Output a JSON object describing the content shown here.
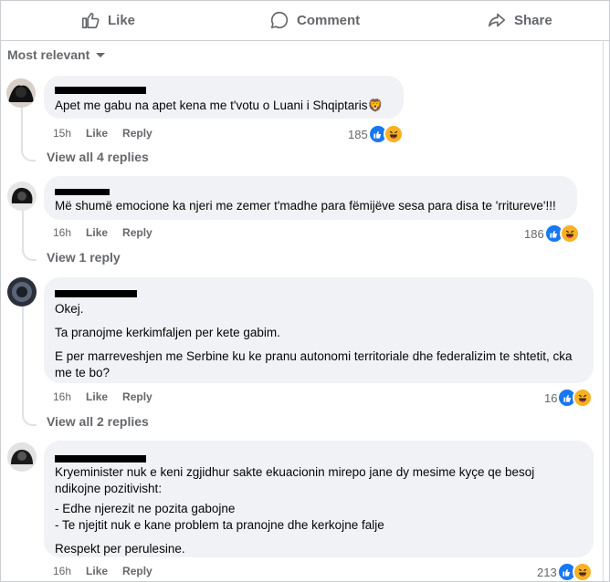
{
  "action_bar": {
    "like": "Like",
    "comment": "Comment",
    "share": "Share"
  },
  "sort": {
    "label": "Most relevant"
  },
  "comments": [
    {
      "text": "Apet me gabu na apet kena me t'votu o Luani i Shqiptaris🦁",
      "time": "15h",
      "like": "Like",
      "reply": "Reply",
      "reactions": "185",
      "view_replies": "View all 4 replies"
    },
    {
      "text": "Më shumë emocione ka njeri me zemer t'madhe para fëmijëve sesa para disa te 'rritureve'!!!",
      "time": "16h",
      "like": "Like",
      "reply": "Reply",
      "reactions": "186",
      "view_replies": "View 1 reply"
    },
    {
      "paragraphs": [
        "Okej.",
        "Ta pranojme kerkimfaljen per kete gabim.",
        "E per marreveshjen me Serbine ku ke pranu autonomi territoriale dhe federalizim te shtetit, cka me te bo?"
      ],
      "time": "16h",
      "like": "Like",
      "reply": "Reply",
      "reactions": "16",
      "view_replies": "View all 2 replies"
    },
    {
      "paragraphs": [
        "Kryeminister nuk e keni zgjidhur sakte ekuacionin mirepo jane dy mesime kyçe qe besoj ndikojne pozitivisht:",
        "- Edhe njerezit ne pozita gabojne",
        "- Te njejtit nuk e kane problem ta pranojne dhe kerkojne falje",
        "Respekt per perulesine."
      ],
      "time": "16h",
      "like": "Like",
      "reply": "Reply",
      "reactions": "213"
    }
  ],
  "colors": {
    "bubble": "#f0f2f5",
    "meta_text": "#65676b",
    "like_reaction": "#1877f2",
    "haha_reaction": "#f7b125"
  },
  "icons": [
    "thumbs-up-icon",
    "comment-icon",
    "share-icon",
    "caret-down-icon",
    "like-reaction-icon",
    "haha-reaction-icon"
  ]
}
